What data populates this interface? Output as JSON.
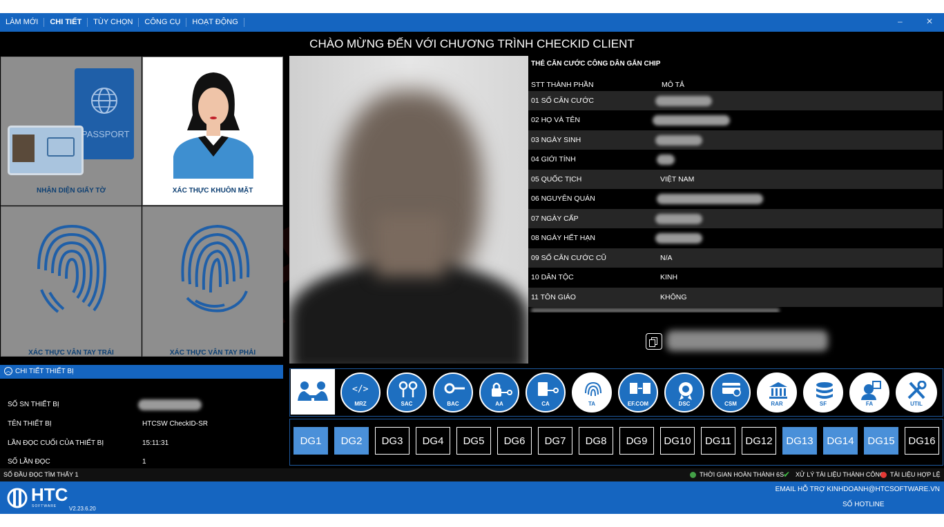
{
  "menu": {
    "items": [
      {
        "label": "LÀM MỚI"
      },
      {
        "label": "CHI TIẾT"
      },
      {
        "label": "TÙY CHỌN"
      },
      {
        "label": "CÔNG CỤ"
      },
      {
        "label": "HOẠT ĐỘNG"
      }
    ],
    "minimize": "–",
    "close": "✕"
  },
  "title": "CHÀO MỪNG ĐẾN VỚI CHƯƠNG TRÌNH CHECKID CLIENT",
  "tiles": {
    "id_doc": "NHẬN DIỆN GIẤY TỜ",
    "passport": "PASSPORT",
    "face": "XÁC THỰC KHUÔN MẶT",
    "left_finger": "XÁC THỰC VÂN TAY TRÁI",
    "right_finger": "XÁC THỰC VÂN TAY PHẢI"
  },
  "device": {
    "header": "CHI TIẾT THIẾT BỊ",
    "serial_label": "SỐ SN THIẾT BỊ",
    "name_label": "TÊN THIẾT BỊ",
    "name_value": "HTCSW CheckID-SR",
    "last_read_label": "LẦN ĐỌC CUỐI CỦA THIẾT BỊ",
    "last_read_value": "15:11:31",
    "read_count_label": "SỐ LẦN ĐỌC",
    "read_count_value": "1"
  },
  "card": {
    "heading": "THẺ CĂN CƯỚC CÔNG DÂN GẮN CHIP",
    "col_component": "STT THÀNH PHẦN",
    "col_desc": "MÔ TẢ",
    "rows": [
      {
        "label": "01  SỐ CĂN CƯỚC",
        "value": ""
      },
      {
        "label": "02  HỌ VÀ TÊN",
        "value": ""
      },
      {
        "label": "03  NGÀY SINH",
        "value": ""
      },
      {
        "label": "04  GIỚI TÍNH",
        "value": ""
      },
      {
        "label": "05  QUỐC TỊCH",
        "value": "VIỆT NAM"
      },
      {
        "label": "06  NGUYÊN QUÁN",
        "value": ""
      },
      {
        "label": "07  NGÀY CẤP",
        "value": ""
      },
      {
        "label": "08  NGÀY HẾT HẠN",
        "value": ""
      },
      {
        "label": "09  SỐ CĂN CƯỚC CŨ",
        "value": "N/A"
      },
      {
        "label": "10  DÂN TỘC",
        "value": "KINH"
      },
      {
        "label": "11  TÔN GIÁO",
        "value": "KHÔNG"
      }
    ],
    "copy_icon": "copy-icon"
  },
  "tools": [
    {
      "label": "MRZ",
      "icon": "code-icon"
    },
    {
      "label": "SAC",
      "icon": "key-pair-icon"
    },
    {
      "label": "BAC",
      "icon": "key-icon"
    },
    {
      "label": "AA",
      "icon": "lock-key-icon"
    },
    {
      "label": "CA",
      "icon": "document-key-icon"
    },
    {
      "label": "TA",
      "icon": "fingerprint-icon"
    },
    {
      "label": "EF.COM",
      "icon": "file-transfer-icon"
    },
    {
      "label": "DSC",
      "icon": "certificate-badge-icon"
    },
    {
      "label": "CSM",
      "icon": "card-check-icon"
    },
    {
      "label": "RAR",
      "icon": "bank-icon"
    },
    {
      "label": "SF",
      "icon": "database-icon"
    },
    {
      "label": "FA",
      "icon": "face-id-icon"
    },
    {
      "label": "UTIL",
      "icon": "tools-icon"
    }
  ],
  "data_groups": [
    {
      "label": "DG1",
      "active": true
    },
    {
      "label": "DG2",
      "active": true
    },
    {
      "label": "DG3",
      "active": false
    },
    {
      "label": "DG4",
      "active": false
    },
    {
      "label": "DG5",
      "active": false
    },
    {
      "label": "DG6",
      "active": false
    },
    {
      "label": "DG7",
      "active": false
    },
    {
      "label": "DG8",
      "active": false
    },
    {
      "label": "DG9",
      "active": false
    },
    {
      "label": "DG10",
      "active": false
    },
    {
      "label": "DG11",
      "active": false
    },
    {
      "label": "DG12",
      "active": false
    },
    {
      "label": "DG13",
      "active": true
    },
    {
      "label": "DG14",
      "active": true
    },
    {
      "label": "DG15",
      "active": true
    },
    {
      "label": "DG16",
      "active": false
    }
  ],
  "status": {
    "readers": "SỐ ĐẦU ĐỌC TÌM THẤY 1",
    "time": "THỜI GIAN HOÀN THÀNH 6S",
    "processed": "XỬ LÝ TÀI LIỆU THÀNH CÔNG",
    "valid": "TÀI LIỆU HỢP LỆ"
  },
  "footer": {
    "logo": "HTC",
    "logo_sub": "SOFTWARE",
    "version": "V2.23.6.20",
    "email": "EMAIL HỖ TRỢ KINHDOANH@HTCSOFTWARE.VN",
    "hotline": "SỐ HOTLINE"
  },
  "colors": {
    "accent": "#1565c0",
    "active_dg": "#4a90d9",
    "tile": "#8e8e8e",
    "label": "#0d3f72"
  }
}
